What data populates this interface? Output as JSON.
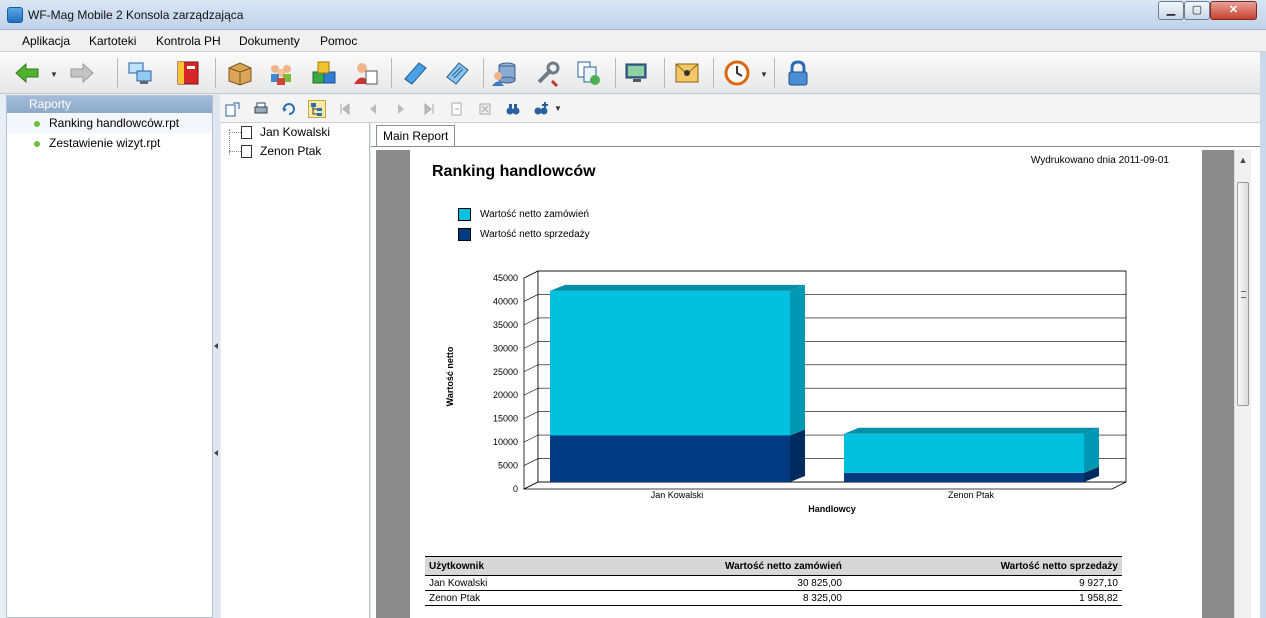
{
  "window": {
    "title": "WF-Mag Mobile 2 Konsola zarządzająca",
    "minimize": "▁",
    "maximize": "▢",
    "close": "✕"
  },
  "menu": [
    "Aplikacja",
    "Kartoteki",
    "Kontrola PH",
    "Dokumenty",
    "Pomoc"
  ],
  "toolbar_icons": [
    "back-arrow-icon",
    "forward-arrow-icon",
    "computers-icon",
    "address-book-icon",
    "package-icon",
    "users-group-icon",
    "boxes-icon",
    "contact-card-icon",
    "book-icon",
    "document-icon",
    "database-user-icon",
    "tools-icon",
    "sync-documents-icon",
    "network-monitor-icon",
    "envelope-icon",
    "clock-icon",
    "lock-icon"
  ],
  "sidebar": {
    "header": "Raporty",
    "items": [
      "Ranking handlowców.rpt",
      "Zestawienie wizyt.rpt"
    ]
  },
  "tree": {
    "nodes": [
      "Jan Kowalski",
      "Zenon Ptak"
    ]
  },
  "report": {
    "tab": "Main Report",
    "title": "Ranking handlowców",
    "printed": "Wydrukowano dnia 2011-09-01",
    "table": {
      "headers": [
        "Użytkownik",
        "Wartość netto zamówień",
        "Wartość netto sprzedaży"
      ],
      "rows": [
        [
          "Jan Kowalski",
          "30 825,00",
          "9 927,10"
        ],
        [
          "Zenon Ptak",
          "8 325,00",
          "1 958,82"
        ]
      ]
    }
  },
  "colors": {
    "orders": "#00c0e0",
    "sales": "#003a80"
  },
  "chart_data": {
    "type": "bar",
    "stacked": true,
    "categories": [
      "Jan Kowalski",
      "Zenon Ptak"
    ],
    "series": [
      {
        "name": "Wartość netto sprzedaży",
        "values": [
          9927.1,
          1958.82
        ]
      },
      {
        "name": "Wartość netto zamówień",
        "values": [
          30825.0,
          8325.0
        ]
      }
    ],
    "legend": [
      "Wartość netto zamówień",
      "Wartość netto sprzedaży"
    ],
    "xlabel": "Handlowcy",
    "ylabel": "Wartość netto",
    "ylim": [
      0,
      45000
    ],
    "yticks": [
      "0",
      "5000",
      "10000",
      "15000",
      "20000",
      "25000",
      "30000",
      "35000",
      "40000",
      "45000"
    ],
    "grid": true,
    "legend_position": "top-left"
  }
}
